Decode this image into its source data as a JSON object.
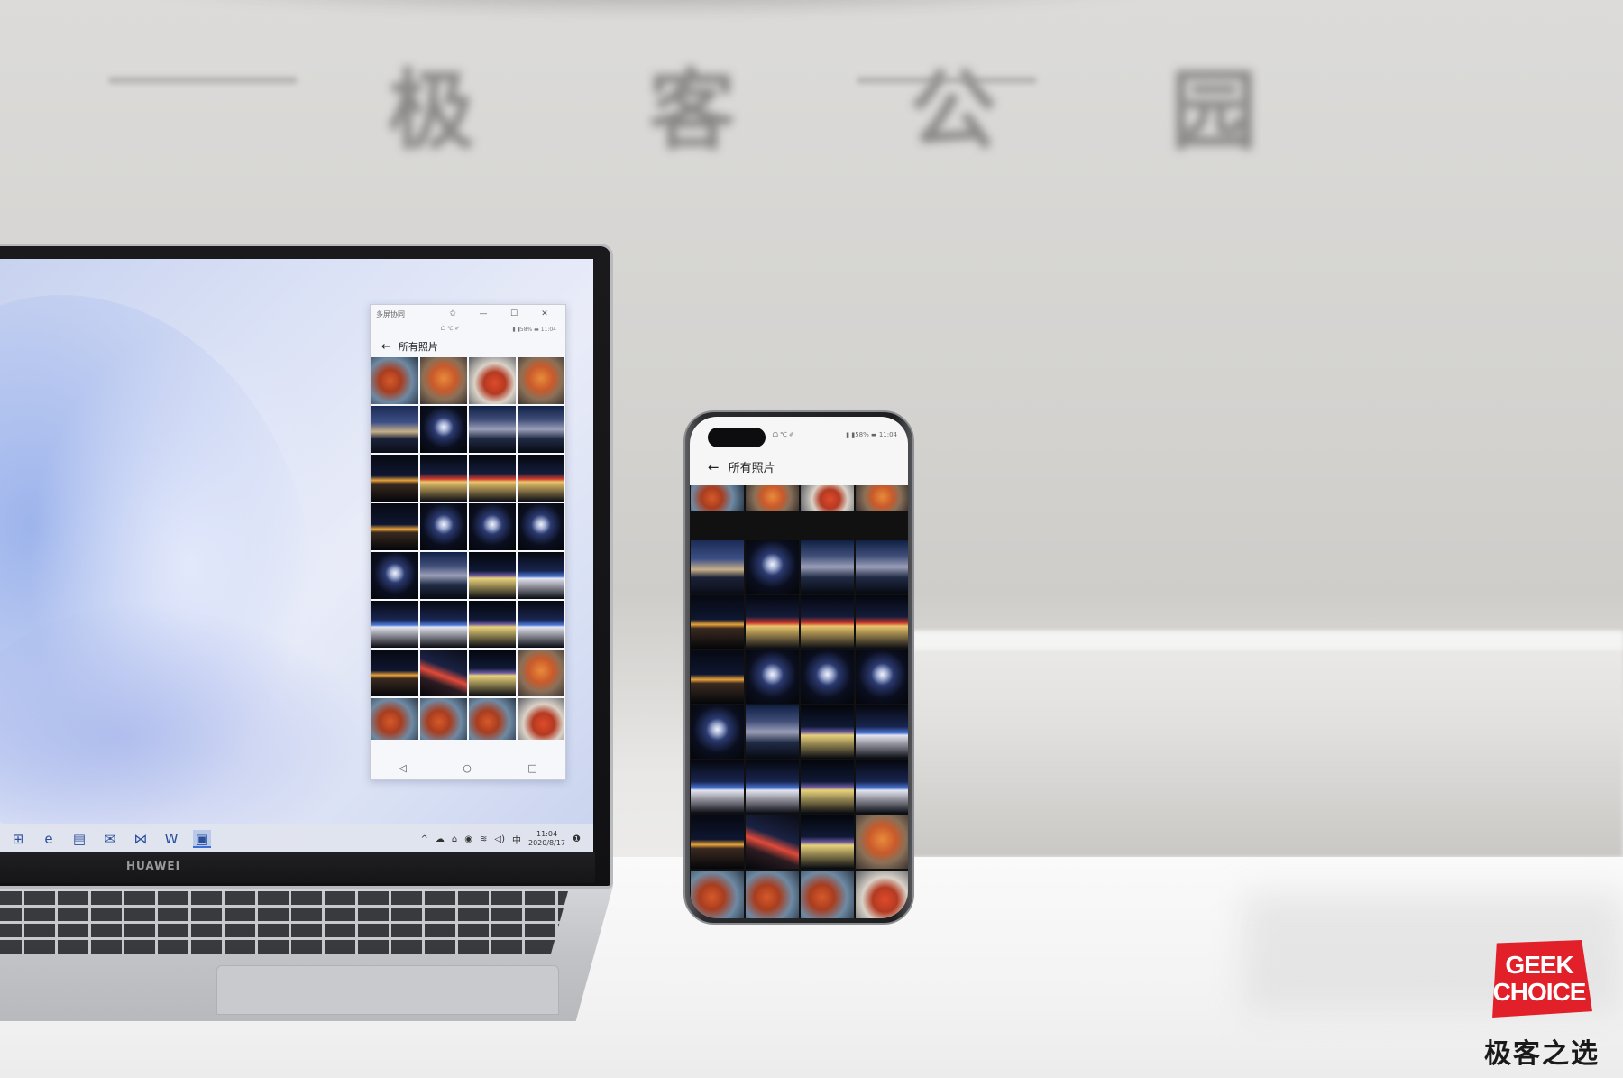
{
  "background_sign": {
    "text": "极 客 公 园"
  },
  "laptop": {
    "brand": "HUAWEI",
    "mirror_window": {
      "title": "多屏协同",
      "controls": [
        "✩",
        "—",
        "☐",
        "✕"
      ],
      "status_left": "ᗝ ℃ ✐",
      "status_right": "▮ ▮58% ▬ 11:04",
      "header_title": "所有照片",
      "back_icon": "←",
      "nav": [
        "◁",
        "○",
        "□"
      ]
    },
    "taskbar": {
      "icons": [
        "task-view-icon",
        "edge-icon",
        "file-explorer-icon",
        "mail-icon",
        "media-icon",
        "word-icon",
        "multi-screen-icon"
      ],
      "icon_glyphs": [
        "⊞",
        "e",
        "▤",
        "✉",
        "⋈",
        "W",
        "▣"
      ],
      "tray": [
        "^",
        "☁",
        "⌂",
        "◉",
        "≋",
        "◁)",
        "中"
      ],
      "time": "11:04",
      "date": "2020/8/17",
      "notify": "❶"
    }
  },
  "phone": {
    "status_left": "ᗝ ℃ ✐",
    "status_right": "▮ ▮58% ▬ 11:04",
    "header_title": "所有照片",
    "back_icon": "←"
  },
  "logo": {
    "line1": "GEEK",
    "line2": "CHOICE",
    "caption": "极客之选"
  }
}
